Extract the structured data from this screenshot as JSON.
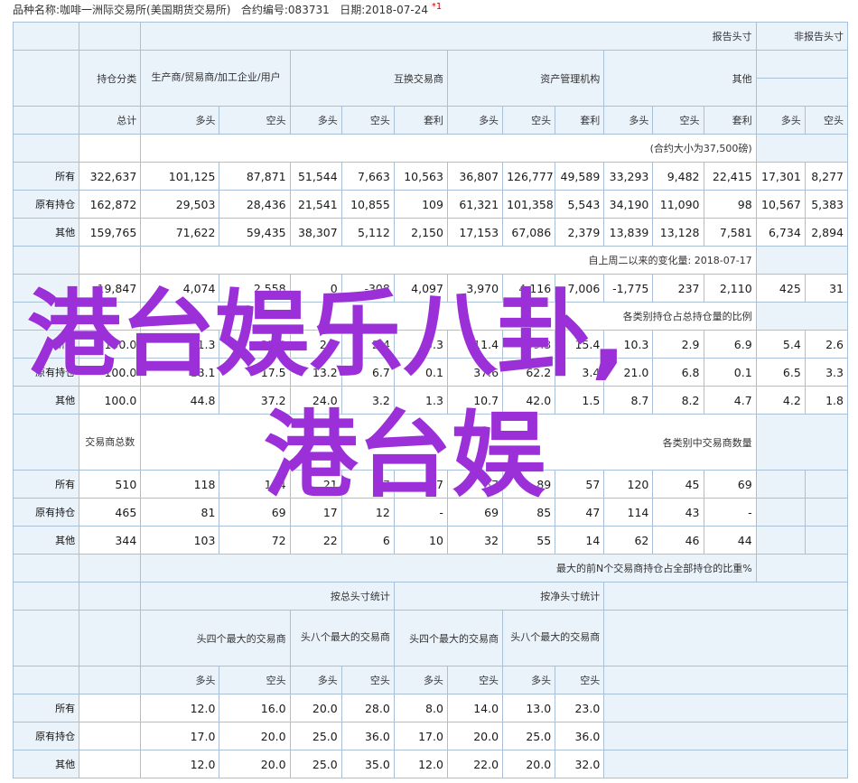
{
  "header": {
    "exchange": "品种名称:咖啡一洲际交易所(美国期货交易所)",
    "code": "合约编号:083731",
    "date": "日期:2018-07-24",
    "star": "*1"
  },
  "section1": {
    "top_group_report": "报告头寸",
    "top_group_nonreport": "非报告头寸",
    "cat_position_class": "持仓分类",
    "cat_producers": "生产商/贸易商/加工企业/用户",
    "cat_swap": "互换交易商",
    "cat_managed": "资产管理机构",
    "cat_other": "其他",
    "sub_total": "总计",
    "sub_long": "多头",
    "sub_short": "空头",
    "sub_spread": "套利",
    "note_contract_size": "(合约大小为37,500磅)",
    "rows": [
      {
        "label": "所有",
        "values": [
          "322,637",
          "101,125",
          "87,871",
          "51,544",
          "7,663",
          "10,563",
          "36,807",
          "126,777",
          "49,589",
          "33,293",
          "9,482",
          "22,415",
          "17,301",
          "8,277"
        ]
      },
      {
        "label": "原有持仓",
        "values": [
          "162,872",
          "29,503",
          "28,436",
          "21,541",
          "10,855",
          "109",
          "61,321",
          "101,358",
          "5,543",
          "34,190",
          "11,090",
          "98",
          "10,567",
          "5,383"
        ]
      },
      {
        "label": "其他",
        "values": [
          "159,765",
          "71,622",
          "59,435",
          "38,307",
          "5,112",
          "2,150",
          "17,153",
          "67,086",
          "2,379",
          "13,839",
          "13,128",
          "7,581",
          "6,734",
          "2,894"
        ]
      }
    ],
    "note_change": "自上周二以来的变化量: 2018-07-17",
    "change_row": [
      "19,847",
      "4,074",
      "2,558",
      "0",
      "-308",
      "4,097",
      "3,970",
      "4,116",
      "7,006",
      "-1,775",
      "237",
      "2,110",
      "425",
      "31"
    ],
    "note_pct": "各类别持仓占总持仓量的比例",
    "pct_rows": [
      {
        "label": "所有",
        "values": [
          "100.0",
          "31.3",
          "27.2",
          "2.4",
          "2.4",
          "3.3",
          "11.4",
          "39.3",
          "15.4",
          "10.3",
          "2.9",
          "6.9",
          "5.4",
          "2.6"
        ]
      },
      {
        "label": "原有持仓",
        "values": [
          "100.0",
          "18.1",
          "17.5",
          "13.2",
          "6.7",
          "0.1",
          "37.6",
          "62.2",
          "3.4",
          "21.0",
          "6.8",
          "0.1",
          "6.5",
          "3.3"
        ]
      },
      {
        "label": "其他",
        "values": [
          "100.0",
          "44.8",
          "37.2",
          "24.0",
          "3.2",
          "1.3",
          "10.7",
          "42.0",
          "1.5",
          "8.7",
          "8.2",
          "4.7",
          "4.2",
          "1.8"
        ]
      }
    ],
    "traders_total": "交易商总数",
    "note_traders": "各类别中交易商数量",
    "trader_rows": [
      {
        "label": "所有",
        "values": [
          "510",
          "118",
          "134",
          "21",
          "7",
          "17",
          "57",
          "89",
          "57",
          "120",
          "45",
          "69",
          "",
          ""
        ]
      },
      {
        "label": "原有持仓",
        "values": [
          "465",
          "81",
          "69",
          "17",
          "12",
          "-",
          "69",
          "85",
          "47",
          "114",
          "43",
          "-",
          "",
          ""
        ]
      },
      {
        "label": "其他",
        "values": [
          "344",
          "103",
          "72",
          "22",
          "6",
          "10",
          "32",
          "55",
          "14",
          "62",
          "46",
          "44",
          "",
          ""
        ]
      }
    ]
  },
  "section2": {
    "title": "最大的前N个交易商持仓占全部持仓的比重%",
    "by_gross": "按总头寸统计",
    "by_net": "按净头寸统计",
    "top4": "头四个最大的交易商",
    "top8": "头八个最大的交易商",
    "sub_long": "多头",
    "sub_short": "空头",
    "rows": [
      {
        "label": "所有",
        "values": [
          "12.0",
          "16.0",
          "20.0",
          "28.0",
          "8.0",
          "14.0",
          "13.0",
          "23.0"
        ]
      },
      {
        "label": "原有持仓",
        "values": [
          "17.0",
          "20.0",
          "25.0",
          "36.0",
          "17.0",
          "20.0",
          "25.0",
          "36.0"
        ]
      },
      {
        "label": "其他",
        "values": [
          "12.0",
          "20.0",
          "25.0",
          "35.0",
          "12.0",
          "22.0",
          "20.0",
          "32.0"
        ]
      }
    ]
  },
  "overlay": {
    "line1": "港台娱乐八卦,",
    "line2": "港台娱"
  }
}
